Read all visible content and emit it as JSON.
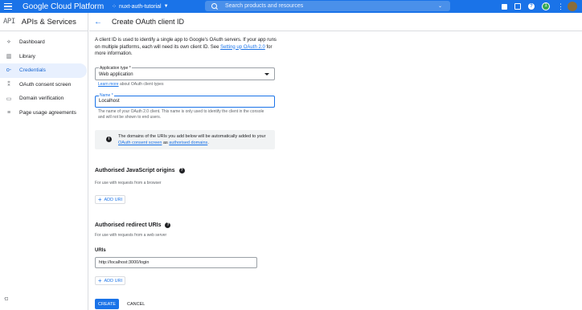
{
  "topbar": {
    "brand": "Google Cloud Platform",
    "project": "nuxt-auth-tutorial",
    "search_placeholder": "Search products and resources"
  },
  "sidebar": {
    "logo": "API",
    "title": "APIs & Services",
    "items": [
      {
        "label": "Dashboard",
        "icon": "dashboard-icon"
      },
      {
        "label": "Library",
        "icon": "library-icon"
      },
      {
        "label": "Credentials",
        "icon": "key-icon",
        "active": true
      },
      {
        "label": "OAuth consent screen",
        "icon": "consent-icon"
      },
      {
        "label": "Domain verification",
        "icon": "domain-icon"
      },
      {
        "label": "Page usage agreements",
        "icon": "agreements-icon"
      }
    ]
  },
  "header": {
    "title": "Create OAuth client ID"
  },
  "main": {
    "intro_text": "A client ID is used to identify a single app to Google's OAuth servers. If your app runs on multiple platforms, each will need its own client ID. See ",
    "intro_link": "Setting up OAuth 2.0",
    "intro_suffix": " for more information.",
    "app_type_label": "Application type *",
    "app_type_value": "Web application",
    "learn_more_link": "Learn more",
    "learn_more_suffix": " about OAuth client types",
    "name_label": "Name *",
    "name_value": "Localhost",
    "name_help": "The name of your OAuth 2.0 client. This name is only used to identify the client in the console and will not be shown to end users.",
    "info_text_prefix": "The domains of the URIs you add below will be automatically added to your ",
    "info_link1": "OAuth consent screen",
    "info_mid": " as ",
    "info_link2": "authorised domains",
    "info_suffix": ".",
    "js_origins_title": "Authorised JavaScript origins",
    "js_origins_help": "For use with requests from a browser",
    "add_uri_label": "ADD URI",
    "redirect_title": "Authorised redirect URIs",
    "redirect_help": "For use with requests from a web server",
    "uris_label": "URIs",
    "uri_value": "http://localhost:3000/login",
    "create_label": "CREATE",
    "cancel_label": "CANCEL"
  },
  "colors": {
    "brand_blue": "#1a73e8",
    "active_bg": "#e8f0fe"
  }
}
